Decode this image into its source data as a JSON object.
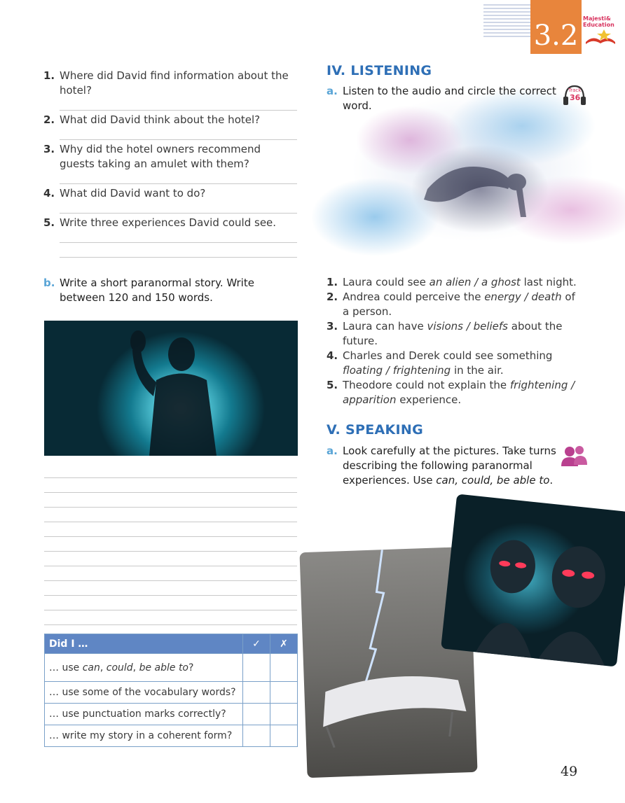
{
  "header": {
    "unit": "3.2",
    "logo_line1": "Majesti&",
    "logo_line2": "Education"
  },
  "questions": [
    {
      "num": "1.",
      "text": "Where did David find information about the hotel?"
    },
    {
      "num": "2.",
      "text": "What did David think about the hotel?"
    },
    {
      "num": "3.",
      "text": "Why did the hotel owners recommend guests taking an amulet with them?"
    },
    {
      "num": "4.",
      "text": "What did David want to do?"
    },
    {
      "num": "5.",
      "text": "Write three experiences David could see."
    }
  ],
  "section_b": {
    "letter": "b.",
    "text": "Write a short paranormal story. Write between 120 and 150 words."
  },
  "checklist": {
    "header": "Did I …",
    "check": "✓",
    "cross": "✗",
    "rows": [
      [
        "… use ",
        "can",
        ", ",
        "could",
        ", ",
        "be able to",
        "?"
      ],
      [
        "… use some of the vocabulary words?"
      ],
      [
        "… use punctuation marks correctly?"
      ],
      [
        "… write my story in a coherent form?"
      ]
    ]
  },
  "listening": {
    "title": "IV. LISTENING",
    "letter": "a.",
    "instruction": "Listen to the audio and circle the correct word.",
    "track_label": "Track",
    "track_number": "36",
    "items": [
      {
        "num": "1.",
        "pre": "Laura could see ",
        "opt": "an alien / a ghost",
        "post": " last night."
      },
      {
        "num": "2.",
        "pre": "Andrea could perceive the ",
        "opt": "energy / death",
        "post": " of a person."
      },
      {
        "num": "3.",
        "pre": "Laura can have ",
        "opt": "visions / beliefs",
        "post": " about the future."
      },
      {
        "num": "4.",
        "pre": "Charles and Derek could see something ",
        "opt": "floating / frightening",
        "post": " in the air."
      },
      {
        "num": "5.",
        "pre": "Theodore could not explain the ",
        "opt": "frightening / apparition",
        "post": " experience."
      }
    ]
  },
  "speaking": {
    "title": "V. SPEAKING",
    "letter": "a.",
    "instruction_pre": "Look carefully at the pictures. Take turns describing the following paranormal experiences. Use ",
    "instruction_em": "can, could, be able to",
    "instruction_post": "."
  },
  "page_number": "49"
}
